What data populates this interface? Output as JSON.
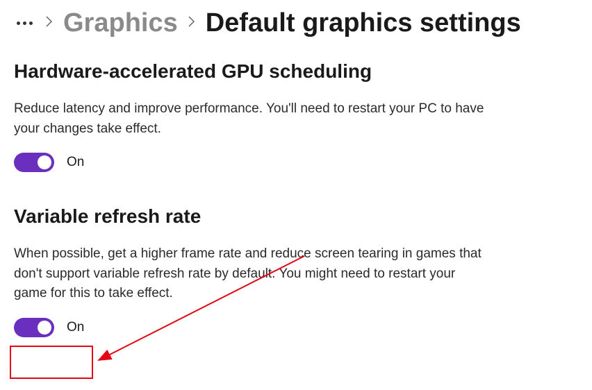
{
  "breadcrumb": {
    "previous": "Graphics",
    "current": "Default graphics settings"
  },
  "sections": {
    "gpu_scheduling": {
      "title": "Hardware-accelerated GPU scheduling",
      "description": "Reduce latency and improve performance. You'll need to restart your PC to have your changes take effect.",
      "toggle_state": "On"
    },
    "vrr": {
      "title": "Variable refresh rate",
      "description": "When possible, get a higher frame rate and reduce screen tearing in games that don't support variable refresh rate by default. You might need to restart your game for this to take effect.",
      "toggle_state": "On"
    }
  },
  "colors": {
    "accent": "#6b2fbf",
    "annotation": "#e40613"
  }
}
